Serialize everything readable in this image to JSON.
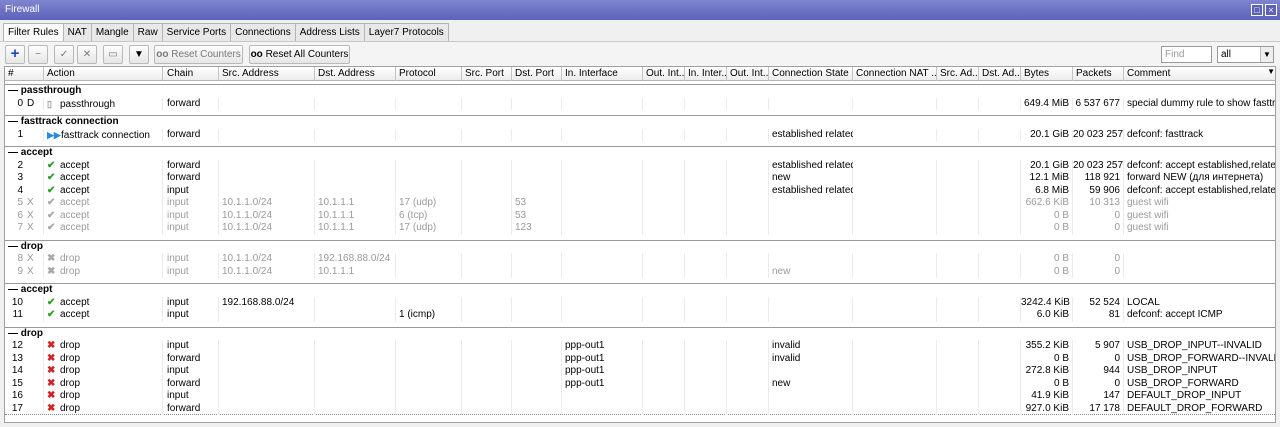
{
  "window": {
    "title": "Firewall"
  },
  "tabs": [
    "Filter Rules",
    "NAT",
    "Mangle",
    "Raw",
    "Service Ports",
    "Connections",
    "Address Lists",
    "Layer7 Protocols"
  ],
  "toolbar": {
    "reset_counters": "Reset Counters",
    "reset_all_counters": "Reset All Counters",
    "find_placeholder": "Find",
    "filter_value": "all"
  },
  "columns": [
    "#",
    "Action",
    "Chain",
    "Src. Address",
    "Dst. Address",
    "Protocol",
    "Src. Port",
    "Dst. Port",
    "In. Interface",
    "Out. Int...",
    "In. Inter...",
    "Out. Int...",
    "Connection State",
    "Connection NAT ...",
    "Src. Ad...",
    "Dst. Ad...",
    "Bytes",
    "Packets",
    "Comment"
  ],
  "groups": [
    {
      "label": "passthrough",
      "rows": [
        {
          "num": "0",
          "flag": "D",
          "action": "passthrough",
          "icon": "passthrough",
          "disabled": false,
          "chain": "forward",
          "src": "",
          "dst": "",
          "proto": "",
          "dport": "",
          "inif": "",
          "state": "",
          "bytes": "649.4 MiB",
          "packets": "6 537 677",
          "comment": "special dummy rule to show fasttrack c"
        }
      ]
    },
    {
      "label": "fasttrack connection",
      "rows": [
        {
          "num": "1",
          "flag": "",
          "action": "fasttrack connection",
          "icon": "fasttrack",
          "disabled": false,
          "chain": "forward",
          "src": "",
          "dst": "",
          "proto": "",
          "dport": "",
          "inif": "",
          "state": "established related",
          "bytes": "20.1 GiB",
          "packets": "20 023 257",
          "comment": "defconf: fasttrack"
        }
      ]
    },
    {
      "label": "accept",
      "rows": [
        {
          "num": "2",
          "flag": "",
          "action": "accept",
          "icon": "accept",
          "disabled": false,
          "chain": "forward",
          "src": "",
          "dst": "",
          "proto": "",
          "dport": "",
          "inif": "",
          "state": "established related",
          "bytes": "20.1 GiB",
          "packets": "20 023 257",
          "comment": "defconf: accept established,related"
        },
        {
          "num": "3",
          "flag": "",
          "action": "accept",
          "icon": "accept",
          "disabled": false,
          "chain": "forward",
          "src": "",
          "dst": "",
          "proto": "",
          "dport": "",
          "inif": "",
          "state": "new",
          "bytes": "12.1 MiB",
          "packets": "118 921",
          "comment": "forward NEW (для интернета)"
        },
        {
          "num": "4",
          "flag": "",
          "action": "accept",
          "icon": "accept",
          "disabled": false,
          "chain": "input",
          "src": "",
          "dst": "",
          "proto": "",
          "dport": "",
          "inif": "",
          "state": "established related",
          "bytes": "6.8 MiB",
          "packets": "59 906",
          "comment": "defconf: accept established,related"
        },
        {
          "num": "5",
          "flag": "X",
          "action": "accept",
          "icon": "accept",
          "disabled": true,
          "chain": "input",
          "src": "10.1.1.0/24",
          "dst": "10.1.1.1",
          "proto": "17 (udp)",
          "dport": "53",
          "inif": "",
          "state": "",
          "bytes": "662.6 KiB",
          "packets": "10 313",
          "comment": "guest wifi"
        },
        {
          "num": "6",
          "flag": "X",
          "action": "accept",
          "icon": "accept",
          "disabled": true,
          "chain": "input",
          "src": "10.1.1.0/24",
          "dst": "10.1.1.1",
          "proto": "6 (tcp)",
          "dport": "53",
          "inif": "",
          "state": "",
          "bytes": "0 B",
          "packets": "0",
          "comment": "guest wifi"
        },
        {
          "num": "7",
          "flag": "X",
          "action": "accept",
          "icon": "accept",
          "disabled": true,
          "chain": "input",
          "src": "10.1.1.0/24",
          "dst": "10.1.1.1",
          "proto": "17 (udp)",
          "dport": "123",
          "inif": "",
          "state": "",
          "bytes": "0 B",
          "packets": "0",
          "comment": "guest wifi"
        }
      ]
    },
    {
      "label": "drop",
      "rows": [
        {
          "num": "8",
          "flag": "X",
          "action": "drop",
          "icon": "drop",
          "disabled": true,
          "chain": "input",
          "src": "10.1.1.0/24",
          "dst": "192.168.88.0/24",
          "proto": "",
          "dport": "",
          "inif": "",
          "state": "",
          "bytes": "0 B",
          "packets": "0",
          "comment": ""
        },
        {
          "num": "9",
          "flag": "X",
          "action": "drop",
          "icon": "drop",
          "disabled": true,
          "chain": "input",
          "src": "10.1.1.0/24",
          "dst": "10.1.1.1",
          "proto": "",
          "dport": "",
          "inif": "",
          "state": "new",
          "bytes": "0 B",
          "packets": "0",
          "comment": ""
        }
      ]
    },
    {
      "label": "accept",
      "rows": [
        {
          "num": "10",
          "flag": "",
          "action": "accept",
          "icon": "accept",
          "disabled": false,
          "chain": "input",
          "src": "192.168.88.0/24",
          "dst": "",
          "proto": "",
          "dport": "",
          "inif": "",
          "state": "",
          "bytes": "3242.4 KiB",
          "packets": "52 524",
          "comment": "LOCAL"
        },
        {
          "num": "11",
          "flag": "",
          "action": "accept",
          "icon": "accept",
          "disabled": false,
          "chain": "input",
          "src": "",
          "dst": "",
          "proto": "1 (icmp)",
          "dport": "",
          "inif": "",
          "state": "",
          "bytes": "6.0 KiB",
          "packets": "81",
          "comment": "defconf: accept ICMP"
        }
      ]
    },
    {
      "label": "drop",
      "rows": [
        {
          "num": "12",
          "flag": "",
          "action": "drop",
          "icon": "drop",
          "disabled": false,
          "chain": "input",
          "src": "",
          "dst": "",
          "proto": "",
          "dport": "",
          "inif": "ppp-out1",
          "state": "invalid",
          "bytes": "355.2 KiB",
          "packets": "5 907",
          "comment": "USB_DROP_INPUT--INVALID"
        },
        {
          "num": "13",
          "flag": "",
          "action": "drop",
          "icon": "drop",
          "disabled": false,
          "chain": "forward",
          "src": "",
          "dst": "",
          "proto": "",
          "dport": "",
          "inif": "ppp-out1",
          "state": "invalid",
          "bytes": "0 B",
          "packets": "0",
          "comment": "USB_DROP_FORWARD--INVALID"
        },
        {
          "num": "14",
          "flag": "",
          "action": "drop",
          "icon": "drop",
          "disabled": false,
          "chain": "input",
          "src": "",
          "dst": "",
          "proto": "",
          "dport": "",
          "inif": "ppp-out1",
          "state": "",
          "bytes": "272.8 KiB",
          "packets": "944",
          "comment": "USB_DROP_INPUT"
        },
        {
          "num": "15",
          "flag": "",
          "action": "drop",
          "icon": "drop",
          "disabled": false,
          "chain": "forward",
          "src": "",
          "dst": "",
          "proto": "",
          "dport": "",
          "inif": "ppp-out1",
          "state": "new",
          "bytes": "0 B",
          "packets": "0",
          "comment": "USB_DROP_FORWARD"
        },
        {
          "num": "16",
          "flag": "",
          "action": "drop",
          "icon": "drop",
          "disabled": false,
          "chain": "input",
          "src": "",
          "dst": "",
          "proto": "",
          "dport": "",
          "inif": "",
          "state": "",
          "bytes": "41.9 KiB",
          "packets": "147",
          "comment": "DEFAULT_DROP_INPUT"
        },
        {
          "num": "17",
          "flag": "",
          "action": "drop",
          "icon": "drop",
          "disabled": false,
          "chain": "forward",
          "src": "",
          "dst": "",
          "proto": "",
          "dport": "",
          "inif": "",
          "state": "",
          "bytes": "927.0 KiB",
          "packets": "17 178",
          "comment": "DEFAULT_DROP_FORWARD"
        }
      ]
    }
  ]
}
